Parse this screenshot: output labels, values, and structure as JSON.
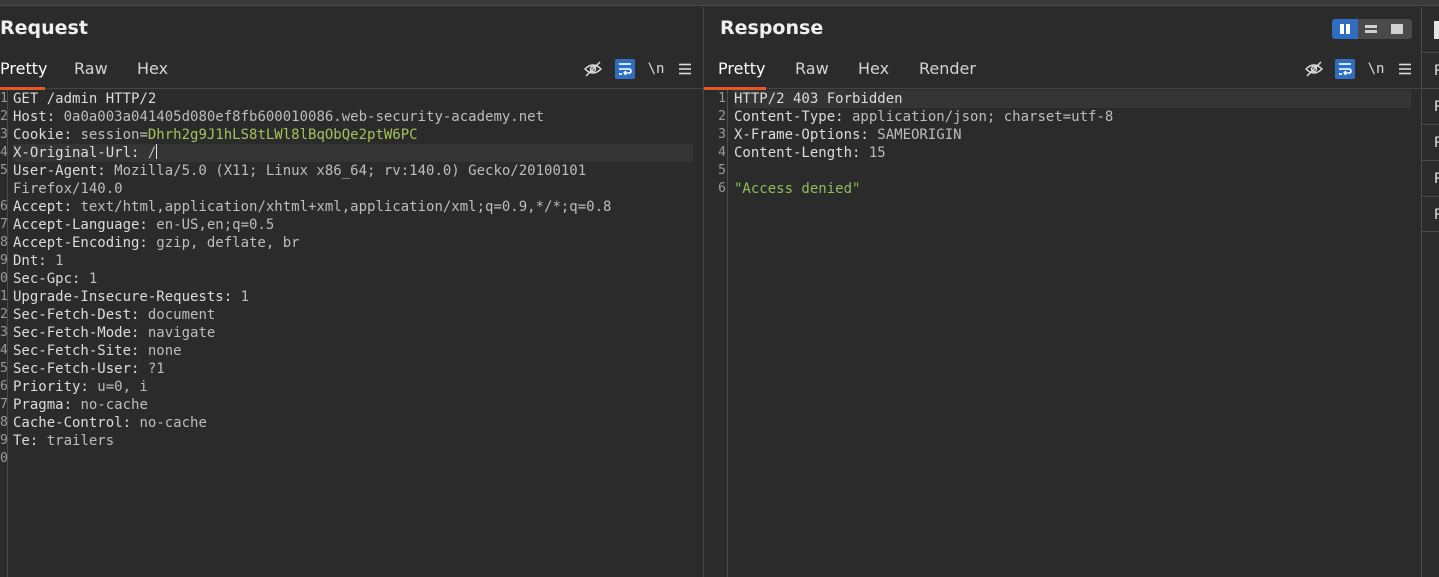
{
  "request": {
    "title": "Request",
    "tabs": [
      "Pretty",
      "Raw",
      "Hex"
    ],
    "active_tab": "Pretty",
    "newline_toggle": "\\n",
    "line_numbers": [
      "1",
      "2",
      "3",
      "4",
      "5",
      "6",
      "7",
      "8",
      "9",
      "0",
      "1",
      "2",
      "3",
      "4",
      "5",
      "6",
      "7",
      "8",
      "9",
      "0"
    ],
    "lines": [
      {
        "text": "GET /admin HTTP/2"
      },
      {
        "key": "Host:",
        "value": " 0a0a003a041405d080ef8fb600010086.web-security-academy.net"
      },
      {
        "key": "Cookie:",
        "value": " session=",
        "session": "Dhrh2g9J1hLS8tLWl8lBqObQe2ptW6PC"
      },
      {
        "key": "X-Original-Url:",
        "value": " /"
      },
      {
        "key": "User-Agent:",
        "value": " Mozilla/5.0 (X11; Linux x86_64; rv:140.0) Gecko/20100101"
      },
      {
        "text": "Firefox/140.0"
      },
      {
        "key": "Accept:",
        "value": " text/html,application/xhtml+xml,application/xml;q=0.9,*/*;q=0.8"
      },
      {
        "key": "Accept-Language:",
        "value": " en-US,en;q=0.5"
      },
      {
        "key": "Accept-Encoding:",
        "value": " gzip, deflate, br"
      },
      {
        "key": "Dnt:",
        "value": " 1"
      },
      {
        "key": "Sec-Gpc:",
        "value": " 1"
      },
      {
        "key": "Upgrade-Insecure-Requests:",
        "value": " 1"
      },
      {
        "key": "Sec-Fetch-Dest:",
        "value": " document"
      },
      {
        "key": "Sec-Fetch-Mode:",
        "value": " navigate"
      },
      {
        "key": "Sec-Fetch-Site:",
        "value": " none"
      },
      {
        "key": "Sec-Fetch-User:",
        "value": " ?1"
      },
      {
        "key": "Priority:",
        "value": " u=0, i"
      },
      {
        "key": "Pragma:",
        "value": " no-cache"
      },
      {
        "key": "Cache-Control:",
        "value": " no-cache"
      },
      {
        "key": "Te:",
        "value": " trailers"
      }
    ]
  },
  "response": {
    "title": "Response",
    "tabs": [
      "Pretty",
      "Raw",
      "Hex",
      "Render"
    ],
    "active_tab": "Pretty",
    "newline_toggle": "\\n",
    "line_numbers": [
      "1",
      "2",
      "3",
      "4",
      "5",
      "6"
    ],
    "lines": [
      {
        "text": "HTTP/2 403 Forbidden"
      },
      {
        "key": "Content-Type:",
        "value": " application/json; charset=utf-8"
      },
      {
        "key": "X-Frame-Options:",
        "value": " SAMEORIGIN"
      },
      {
        "key": "Content-Length:",
        "value": " 15"
      },
      {
        "text": ""
      },
      {
        "string": "\"Access denied\""
      }
    ]
  },
  "right_column": {
    "items": [
      "R",
      "R",
      "R",
      "R",
      "R"
    ]
  },
  "colors": {
    "accent_orange": "#e8572a",
    "toggle_blue": "#2f6dc1",
    "cookie_value": "#a6c25a",
    "json_string": "#8fbf5a"
  },
  "icons": {
    "hide": "eye-slash-icon",
    "wrap": "wrap-lines-icon",
    "menu": "hamburger-menu-icon"
  }
}
